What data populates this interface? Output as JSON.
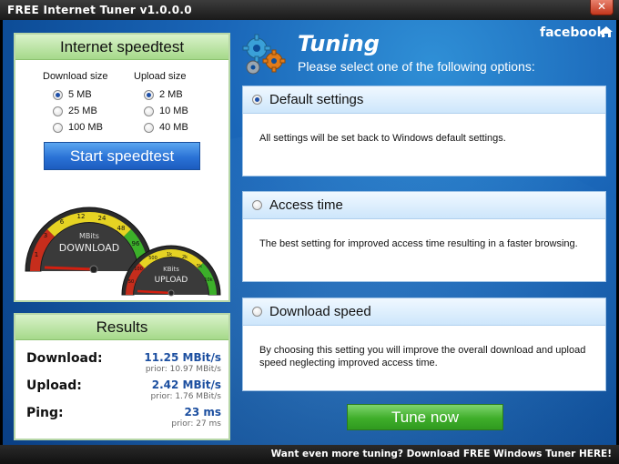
{
  "window": {
    "title": "FREE Internet Tuner v1.0.0.0",
    "close_label": "✕"
  },
  "speedtest": {
    "title": "Internet speedtest",
    "download": {
      "header": "Download size",
      "options": [
        "5 MB",
        "25 MB",
        "100 MB"
      ],
      "selected": "5 MB"
    },
    "upload": {
      "header": "Upload size",
      "options": [
        "2 MB",
        "10 MB",
        "40 MB"
      ],
      "selected": "2 MB"
    },
    "start_label": "Start speedtest",
    "gauge_download": {
      "unit": "MBits",
      "label": "DOWNLOAD",
      "ticks": [
        "1",
        "3",
        "6",
        "12",
        "24",
        "48",
        "96"
      ]
    },
    "gauge_upload": {
      "unit": "KBits",
      "label": "UPLOAD",
      "ticks": [
        "50",
        "100",
        "500",
        "1k",
        "2k",
        "5k",
        "10k"
      ]
    }
  },
  "results": {
    "title": "Results",
    "rows": [
      {
        "label": "Download:",
        "value": "11.25 MBit/s",
        "prior": "prior: 10.97 MBit/s"
      },
      {
        "label": "Upload:",
        "value": "2.42 MBit/s",
        "prior": "prior: 1.76 MBit/s"
      },
      {
        "label": "Ping:",
        "value": "23 ms",
        "prior": "prior: 27 ms"
      }
    ]
  },
  "tuning": {
    "title": "Tuning",
    "subtitle": "Please select one of the following options:",
    "facebook": "facebook",
    "options": [
      {
        "label": "Default settings",
        "desc": "All settings will be set back to Windows default settings.",
        "selected": true
      },
      {
        "label": "Access time",
        "desc": "The best setting for improved access time resulting in a faster browsing.",
        "selected": false
      },
      {
        "label": "Download speed",
        "desc": "By choosing this setting you will improve the overall download and upload speed neglecting improved access time.",
        "selected": false
      }
    ],
    "tune_label": "Tune now"
  },
  "status": {
    "promo": "Want even more tuning? Download FREE Windows Tuner HERE!"
  },
  "colors": {
    "accent_blue": "#2a72d6",
    "accent_green": "#3fae2a",
    "background": "#1a66b8"
  }
}
